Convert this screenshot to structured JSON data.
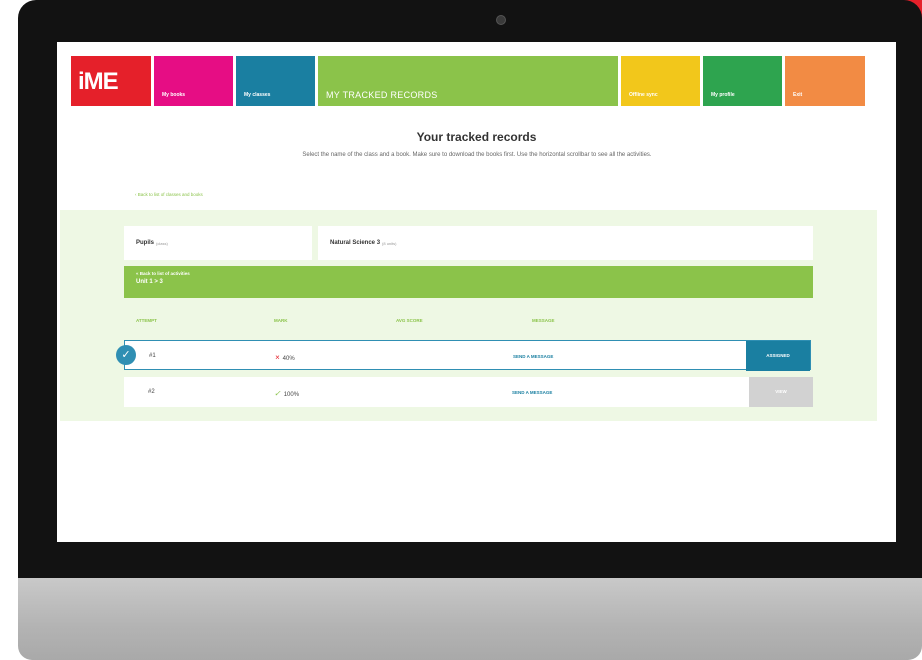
{
  "nav": {
    "logo": "iME",
    "books": "My books",
    "classes": "My classes",
    "tracked": "MY TRACKED RECORDS",
    "offline": "Offline sync",
    "profile": "My profile",
    "exit": "Exit"
  },
  "heading": "Your tracked records",
  "subtext": "Select the name of the class and a book. Make sure to download the books first. Use the horizontal scrollbar to see all the activities.",
  "back_link": "‹ Back to list of classes and books",
  "selectors": {
    "class_label": "Pupils",
    "class_meta": "(class)",
    "book_label": "Natural Science 3",
    "book_meta": "(8 units)"
  },
  "unit_bar": {
    "back": "« Back to list of activities",
    "unit": "Unit 1 > 3"
  },
  "columns": [
    "ATTEMPT",
    "MARK",
    "AVG SCORE",
    "MESSAGE"
  ],
  "rows": [
    {
      "attempt": "#1",
      "mark_icon": "×",
      "mark": "40%",
      "message": "SEND A MESSAGE",
      "action": "ASSIGNED",
      "selected": "✓"
    },
    {
      "attempt": "#2",
      "mark_icon": "✓",
      "mark": "100%",
      "message": "SEND A MESSAGE",
      "action": "VIEW"
    }
  ],
  "colors": {
    "red": "#e5202a",
    "magenta": "#e60d84",
    "blue": "#1a7fa1",
    "green": "#8bc34a",
    "yellow": "#f2c71b",
    "dark_green": "#2ea44f",
    "orange": "#f28b44"
  }
}
